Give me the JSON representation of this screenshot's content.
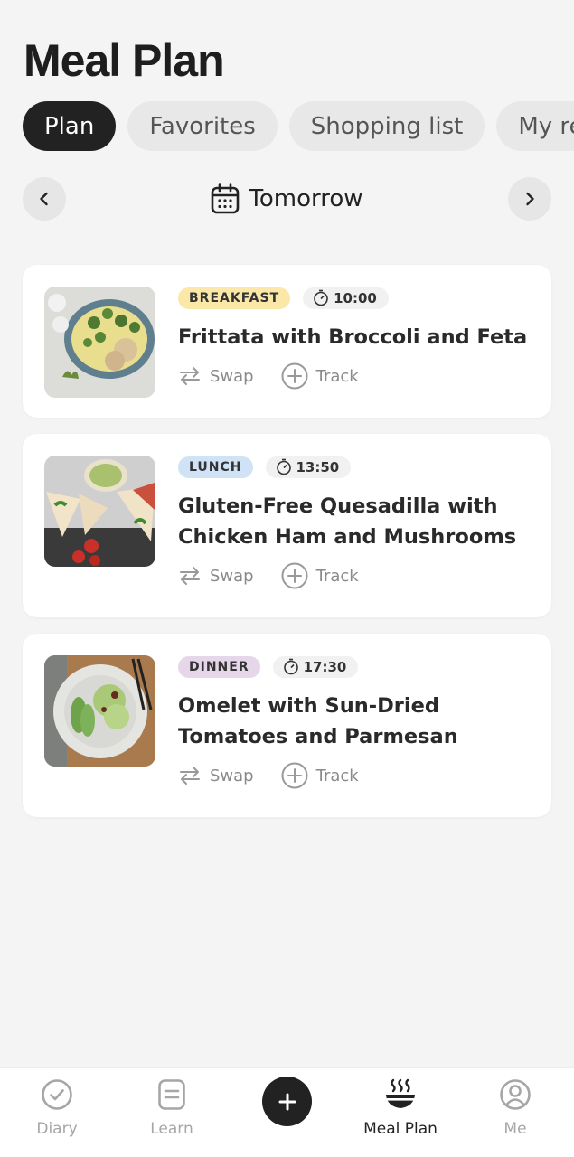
{
  "header": {
    "title": "Meal Plan"
  },
  "tabs": [
    {
      "label": "Plan"
    },
    {
      "label": "Favorites"
    },
    {
      "label": "Shopping list"
    },
    {
      "label": "My recipes"
    }
  ],
  "date_nav": {
    "label": "Tomorrow",
    "prev_icon": "chevron-left-icon",
    "next_icon": "chevron-right-icon",
    "calendar_icon": "calendar-icon"
  },
  "meals": [
    {
      "type": "BREAKFAST",
      "time": "10:00",
      "title": "Frittata with Broccoli and Feta",
      "badge_color": "#fbe8a8",
      "swap": "Swap",
      "track": "Track"
    },
    {
      "type": "LUNCH",
      "time": "13:50",
      "title": "Gluten-Free Quesadilla with Chicken Ham and Mushrooms",
      "badge_color": "#cfe2f6",
      "swap": "Swap",
      "track": "Track"
    },
    {
      "type": "DINNER",
      "time": "17:30",
      "title": "Omelet with Sun-Dried Tomatoes and Parmesan",
      "badge_color": "#e6d6ea",
      "swap": "Swap",
      "track": "Track"
    }
  ],
  "bottom_nav": [
    {
      "label": "Diary",
      "icon": "check-circle-icon",
      "active": false
    },
    {
      "label": "Learn",
      "icon": "document-icon",
      "active": false
    },
    {
      "label": "",
      "icon": "plus-icon",
      "active": false
    },
    {
      "label": "Meal Plan",
      "icon": "bowl-icon",
      "active": true
    },
    {
      "label": "Me",
      "icon": "user-icon",
      "active": false
    }
  ]
}
